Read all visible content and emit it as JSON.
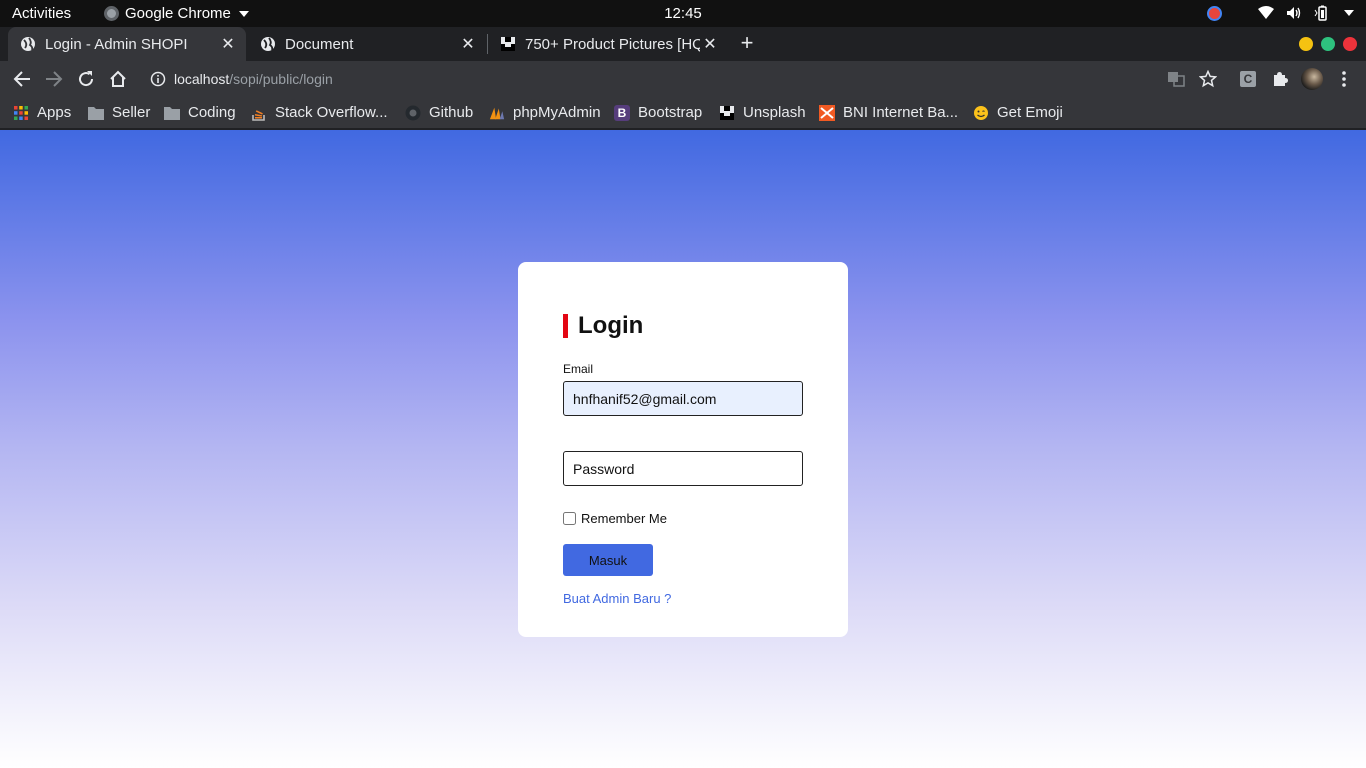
{
  "system_bar": {
    "activities": "Activities",
    "app_name": "Google Chrome",
    "clock": "12:45"
  },
  "tabs": [
    {
      "title": "Login - Admin SHOPI",
      "active": true
    },
    {
      "title": "Document",
      "active": false
    },
    {
      "title": "750+ Product Pictures [HQ",
      "active": false
    }
  ],
  "toolbar": {
    "url_host": "localhost",
    "url_path": "/sopi/public/login",
    "profile_initial": "C"
  },
  "bookmarks": [
    {
      "label": "Apps",
      "icon": "apps-grid-icon"
    },
    {
      "label": "Seller",
      "icon": "folder-icon"
    },
    {
      "label": "Coding",
      "icon": "folder-icon"
    },
    {
      "label": "Stack Overflow...",
      "icon": "stackoverflow-icon"
    },
    {
      "label": "Github",
      "icon": "github-icon"
    },
    {
      "label": "phpMyAdmin",
      "icon": "phpmyadmin-icon"
    },
    {
      "label": "Bootstrap",
      "icon": "bootstrap-icon"
    },
    {
      "label": "Unsplash",
      "icon": "unsplash-icon"
    },
    {
      "label": "BNI Internet Ba...",
      "icon": "bni-icon"
    },
    {
      "label": "Get Emoji",
      "icon": "emoji-icon"
    }
  ],
  "login": {
    "title": "Login",
    "email_label": "Email",
    "email_value": "hnfhanif52@gmail.com",
    "password_placeholder": "Password",
    "remember_label": "Remember Me",
    "submit_label": "Masuk",
    "register_link": "Buat Admin Baru ?"
  },
  "colors": {
    "accent": "#4169e1",
    "title_bar": "#e30613",
    "gradient_top": "#4169e1",
    "gradient_bottom": "#ffffff"
  }
}
